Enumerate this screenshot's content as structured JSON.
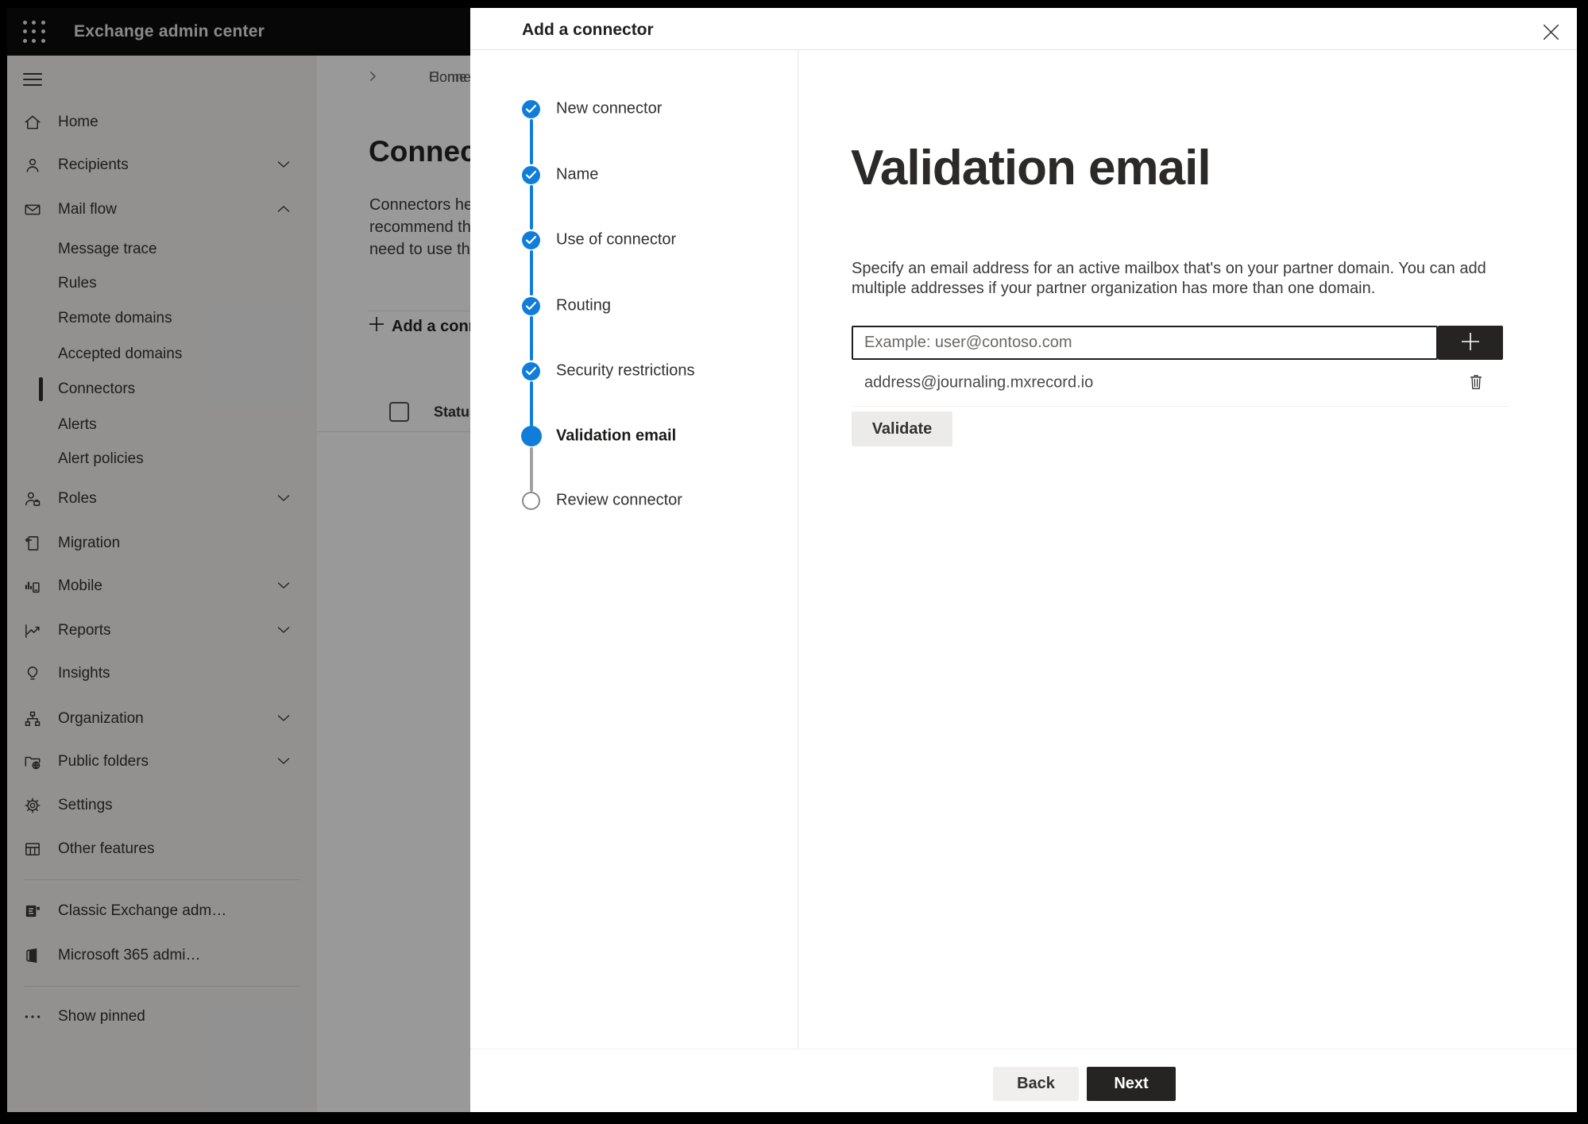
{
  "topbar": {
    "title": "Exchange admin center"
  },
  "sidebar": {
    "items": [
      {
        "label": "Home"
      },
      {
        "label": "Recipients"
      },
      {
        "label": "Mail flow"
      },
      {
        "label": "Message trace"
      },
      {
        "label": "Rules"
      },
      {
        "label": "Remote domains"
      },
      {
        "label": "Accepted domains"
      },
      {
        "label": "Connectors"
      },
      {
        "label": "Alerts"
      },
      {
        "label": "Alert policies"
      },
      {
        "label": "Roles"
      },
      {
        "label": "Migration"
      },
      {
        "label": "Mobile"
      },
      {
        "label": "Reports"
      },
      {
        "label": "Insights"
      },
      {
        "label": "Organization"
      },
      {
        "label": "Public folders"
      },
      {
        "label": "Settings"
      },
      {
        "label": "Other features"
      },
      {
        "label": "Classic Exchange adm…"
      },
      {
        "label": "Microsoft 365 admi…"
      },
      {
        "label": "Show pinned"
      }
    ]
  },
  "page": {
    "breadcrumb": {
      "home": "Home",
      "current": "Connectors"
    },
    "title": "Connectors",
    "description_lines": {
      "l1": "Connectors help",
      "l2": "recommend that",
      "l3": "need to use ther"
    },
    "toolbar": {
      "add_label": "Add a connector"
    },
    "table": {
      "status_header": "Status"
    }
  },
  "modal": {
    "title": "Add a connector",
    "steps": [
      {
        "label": "New connector",
        "state": "completed"
      },
      {
        "label": "Name",
        "state": "completed"
      },
      {
        "label": "Use of connector",
        "state": "completed"
      },
      {
        "label": "Routing",
        "state": "completed"
      },
      {
        "label": "Security restrictions",
        "state": "completed"
      },
      {
        "label": "Validation email",
        "state": "current"
      },
      {
        "label": "Review connector",
        "state": "upcoming"
      }
    ],
    "content": {
      "heading": "Validation email",
      "description_line1": "Specify an email address for an active mailbox that's on your partner domain. You can add",
      "description_line2": "multiple addresses if your partner organization has more than one domain.",
      "email_input": {
        "value": "",
        "placeholder": "Example: user@contoso.com"
      },
      "addresses": [
        {
          "email": "address@journaling.mxrecord.io"
        }
      ],
      "validate_label": "Validate"
    },
    "footer": {
      "back_label": "Back",
      "next_label": "Next"
    }
  },
  "colors": {
    "accent_blue": "#0f7dd9",
    "dark_button": "#252423",
    "sidebar_bg": "#f3f2f1",
    "overlay": "rgba(0,0,0,0.40)"
  }
}
